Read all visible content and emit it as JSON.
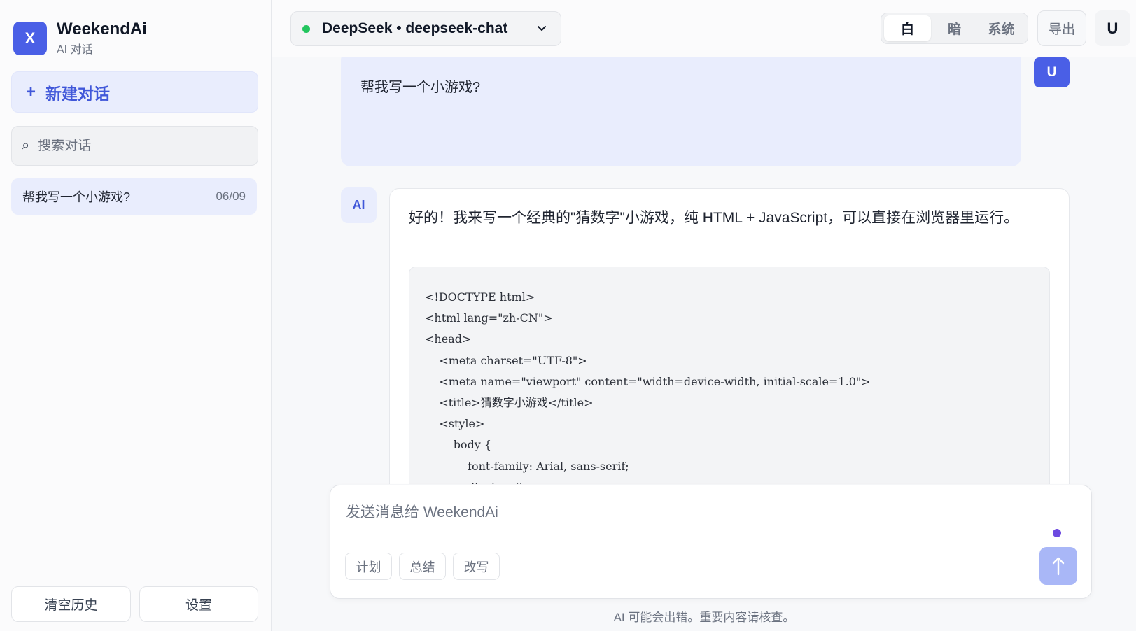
{
  "sidebar": {
    "brand": {
      "logo_letter": "X",
      "title": "WeekendAi",
      "subtitle": "AI 对话"
    },
    "new_chat_label": "新建对话",
    "search": {
      "placeholder": "搜索对话"
    },
    "conversations": [
      {
        "title": "帮我写一个小游戏?",
        "date": "06/09"
      }
    ],
    "clear_history_label": "清空历史",
    "settings_label": "设置"
  },
  "topbar": {
    "model_label": "DeepSeek • deepseek-chat",
    "theme_options": [
      "白",
      "暗",
      "系统"
    ],
    "theme_selected": "白",
    "export_label": "导出",
    "user_initial": "U"
  },
  "chat": {
    "user_message": "帮我写一个小游戏?",
    "user_avatar": "U",
    "ai_avatar": "AI",
    "ai_message": "好的！我来写一个经典的\"猜数字\"小游戏，纯 HTML + JavaScript，可以直接在浏览器里运行。",
    "code_lines": [
      "<!DOCTYPE html>",
      "<html lang=\"zh-CN\">",
      "<head>",
      "    <meta charset=\"UTF-8\">",
      "    <meta name=\"viewport\" content=\"width=device-width, initial-scale=1.0\">",
      "    <title>猜数字小游戏</title>",
      "    <style>",
      "        body {",
      "            font-family: Arial, sans-serif;",
      "            display: flex;"
    ]
  },
  "composer": {
    "placeholder": "发送消息给 WeekendAi",
    "chips": [
      "计划",
      "总结",
      "改写"
    ]
  },
  "footer": {
    "disclaimer": "AI 可能会出错。重要内容请核查。"
  },
  "colors": {
    "accent": "#4a5fe6",
    "accent_soft": "#e9edfd",
    "online": "#22c55e",
    "send_disabled": "#a9b7f7"
  }
}
